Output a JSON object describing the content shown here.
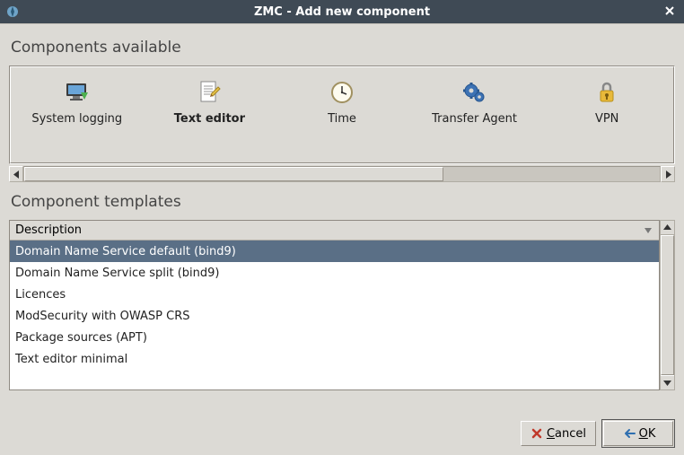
{
  "window": {
    "title": "ZMC - Add new component"
  },
  "sections": {
    "available": "Components available",
    "templates": "Component templates"
  },
  "components": {
    "items": [
      {
        "id": "system-logging",
        "label": "System logging",
        "icon": "monitor-log-icon"
      },
      {
        "id": "text-editor",
        "label": "Text editor",
        "icon": "document-edit-icon",
        "selected": true
      },
      {
        "id": "time",
        "label": "Time",
        "icon": "clock-icon"
      },
      {
        "id": "transfer-agent",
        "label": "Transfer Agent",
        "icon": "gears-icon"
      },
      {
        "id": "vpn",
        "label": "VPN",
        "icon": "lock-shield-icon"
      }
    ]
  },
  "templates": {
    "header": "Description",
    "rows": [
      {
        "label": "Domain Name Service default (bind9)",
        "selected": true
      },
      {
        "label": "Domain Name Service split (bind9)"
      },
      {
        "label": "Licences"
      },
      {
        "label": "ModSecurity with OWASP CRS"
      },
      {
        "label": "Package sources (APT)"
      },
      {
        "label": "Text editor minimal"
      }
    ]
  },
  "buttons": {
    "cancel": "Cancel",
    "ok": "OK"
  }
}
